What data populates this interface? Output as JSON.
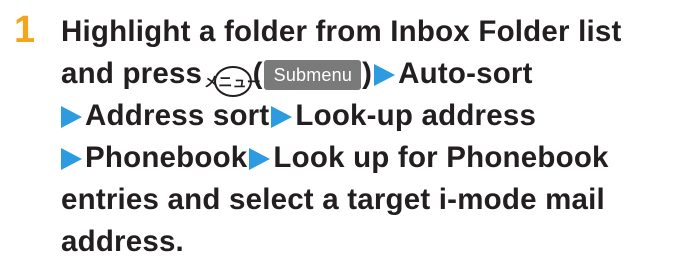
{
  "step": {
    "number": "1",
    "line1": "Highlight a folder from Inbox Folder list",
    "line2_prefix": "and press",
    "key_label": "メニュー",
    "paren_open": "(",
    "softkey_label": "Submenu",
    "paren_close": ")",
    "auto_sort": "Auto-sort",
    "address_sort": "Address sort",
    "look_up_address": "Look-up address",
    "phonebook": "Phonebook",
    "look_up_entries": "Look up for Phonebook",
    "line5": "entries and select a target i-mode mail",
    "line6": "address."
  },
  "colors": {
    "step_number": "#f2a51d",
    "arrow": "#2c9be0",
    "softkey_bg": "#7a7a7a",
    "text": "#231f20"
  },
  "icons": {
    "key": "menu-key-icon",
    "arrow": "triangle-right-arrow-icon"
  }
}
